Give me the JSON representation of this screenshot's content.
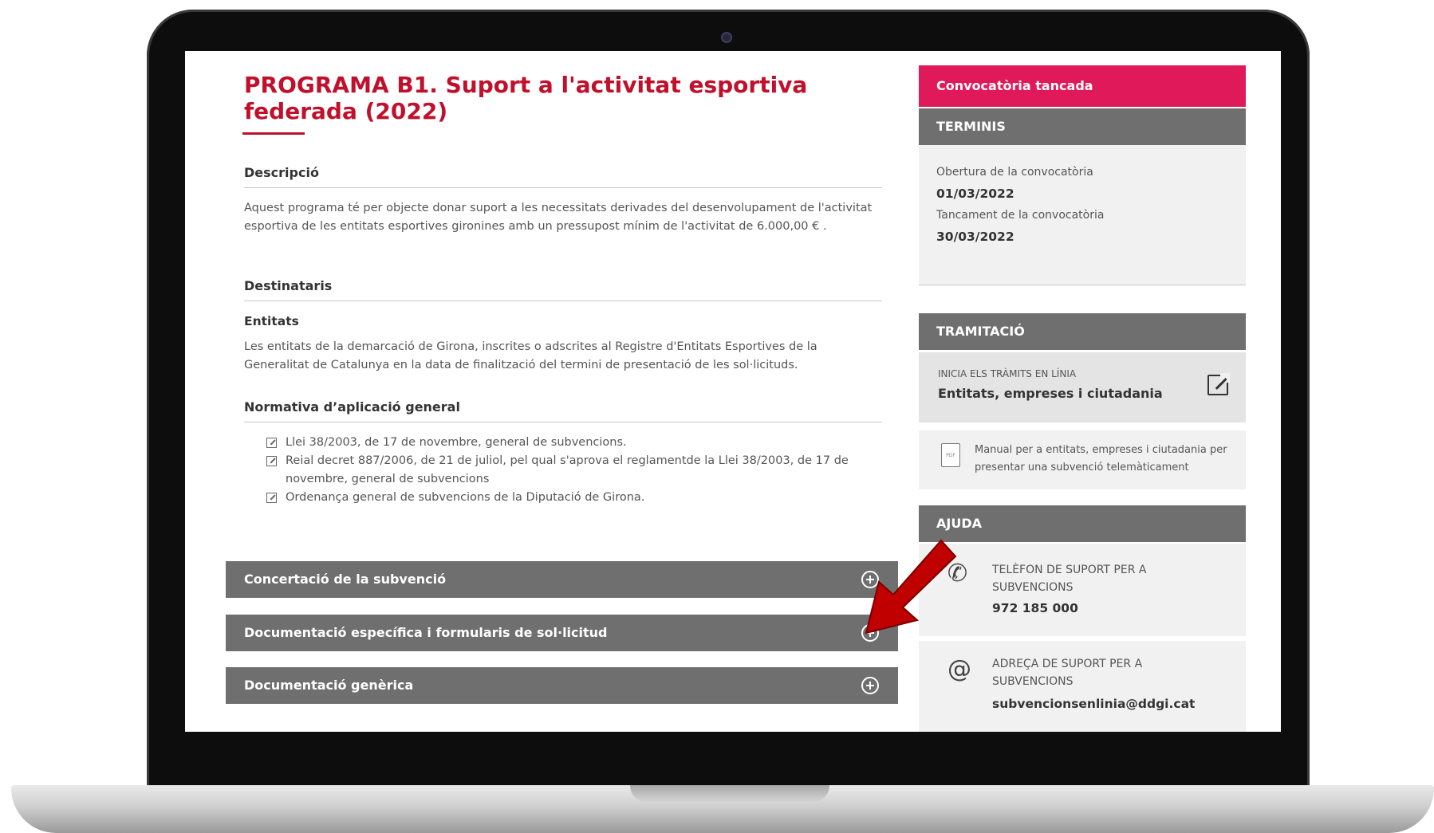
{
  "main": {
    "title": "PROGRAMA B1. Suport a l'activitat esportiva federada (2022)",
    "descripcio": {
      "heading": "Descripció",
      "text": "Aquest programa té per objecte donar suport a les necessitats derivades del desenvolupament de l'activitat esportiva de les entitats esportives gironines amb un pressupost mínim de l'activitat de 6.000,00 €     ."
    },
    "destinataris": {
      "heading": "Destinataris",
      "subheading": "Entitats",
      "text": "Les entitats de la demarcació de Girona, inscrites o adscrites al Registre d'Entitats Esportives de la Generalitat de Catalunya en la data de finalització del termini de presentació de les sol·licituds."
    },
    "normativa": {
      "heading": "Normativa d’aplicació general",
      "items": [
        "Llei 38/2003, de 17 de novembre, general de subvencions.",
        "Reial decret 887/2006, de 21 de juliol, pel qual s'aprova el reglamentde la Llei 38/2003, de 17 de novembre, general de subvencions",
        "Ordenança general de subvencions de la Diputació de Girona."
      ]
    },
    "accordions": [
      "Concertació de la subvenció",
      "Documentació específica i formularis de sol·licitud",
      "Documentació genèrica"
    ]
  },
  "side": {
    "status_badge": "Convocatòria tancada",
    "status_color": "#e0195a",
    "terminis": {
      "heading": "TERMINIS",
      "open_label": "Obertura de la convocatòria",
      "open_date": "01/03/2022",
      "close_label": "Tancament de la convocatòria",
      "close_date": "30/03/2022"
    },
    "tramitacio": {
      "heading": "TRAMITACIÓ",
      "small_label": "INICIA ELS TRÀMITS EN LÍNIA",
      "link_label": "Entitats, empreses i ciutadania",
      "manual_text": "Manual per a entitats, empreses i ciutadania per presentar una subvenció telemàticament",
      "pdf_icon_text": "PDF"
    },
    "ajuda": {
      "heading": "AJUDA",
      "phone_label": "TELÈFON DE SUPORT PER A SUBVENCIONS",
      "phone_value": "972 185 000",
      "email_label": "ADREÇA DE SUPORT PER A SUBVENCIONS",
      "email_value": "subvencionsenlinia@ddgi.cat"
    }
  },
  "icons": {
    "phone": "phone-icon",
    "email": "at-sign-icon",
    "expand": "plus-circle-icon",
    "external": "external-link-icon",
    "pdf": "pdf-file-icon"
  },
  "colors": {
    "title": "#c0102b",
    "accordion_bg": "#6f6f6f",
    "panel_bg": "#f1f1f1",
    "arrow": "#c00000"
  }
}
